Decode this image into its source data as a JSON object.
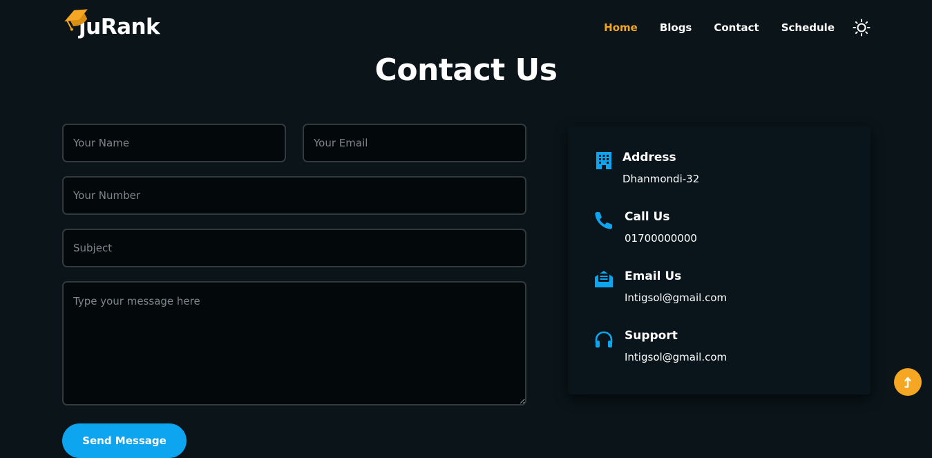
{
  "brand": {
    "name": "juRank"
  },
  "nav": {
    "items": [
      {
        "label": "Home",
        "active": true
      },
      {
        "label": "Blogs",
        "active": false
      },
      {
        "label": "Contact",
        "active": false
      },
      {
        "label": "Schedule",
        "active": false
      }
    ],
    "theme_toggle_icon": "sun-icon"
  },
  "page": {
    "title": "Contact Us"
  },
  "form": {
    "name": {
      "placeholder": "Your Name",
      "value": ""
    },
    "email": {
      "placeholder": "Your Email",
      "value": ""
    },
    "number": {
      "placeholder": "Your Number",
      "value": ""
    },
    "subject": {
      "placeholder": "Subject",
      "value": ""
    },
    "message": {
      "placeholder": "Type your message here",
      "value": ""
    },
    "submit_label": "Send Message"
  },
  "contact_info": [
    {
      "icon": "building-icon",
      "title": "Address",
      "value": "Dhanmondi-32"
    },
    {
      "icon": "phone-icon",
      "title": "Call Us",
      "value": "01700000000"
    },
    {
      "icon": "envelope-icon",
      "title": "Email Us",
      "value": "Intigsol@gmail.com"
    },
    {
      "icon": "headphones-icon",
      "title": "Support",
      "value": "Intigsol@gmail.com"
    }
  ],
  "colors": {
    "accent": "#f5a623",
    "primary": "#0ea5f0",
    "background": "#0a1419",
    "field_background": "#03080b",
    "field_border": "#323a40"
  }
}
